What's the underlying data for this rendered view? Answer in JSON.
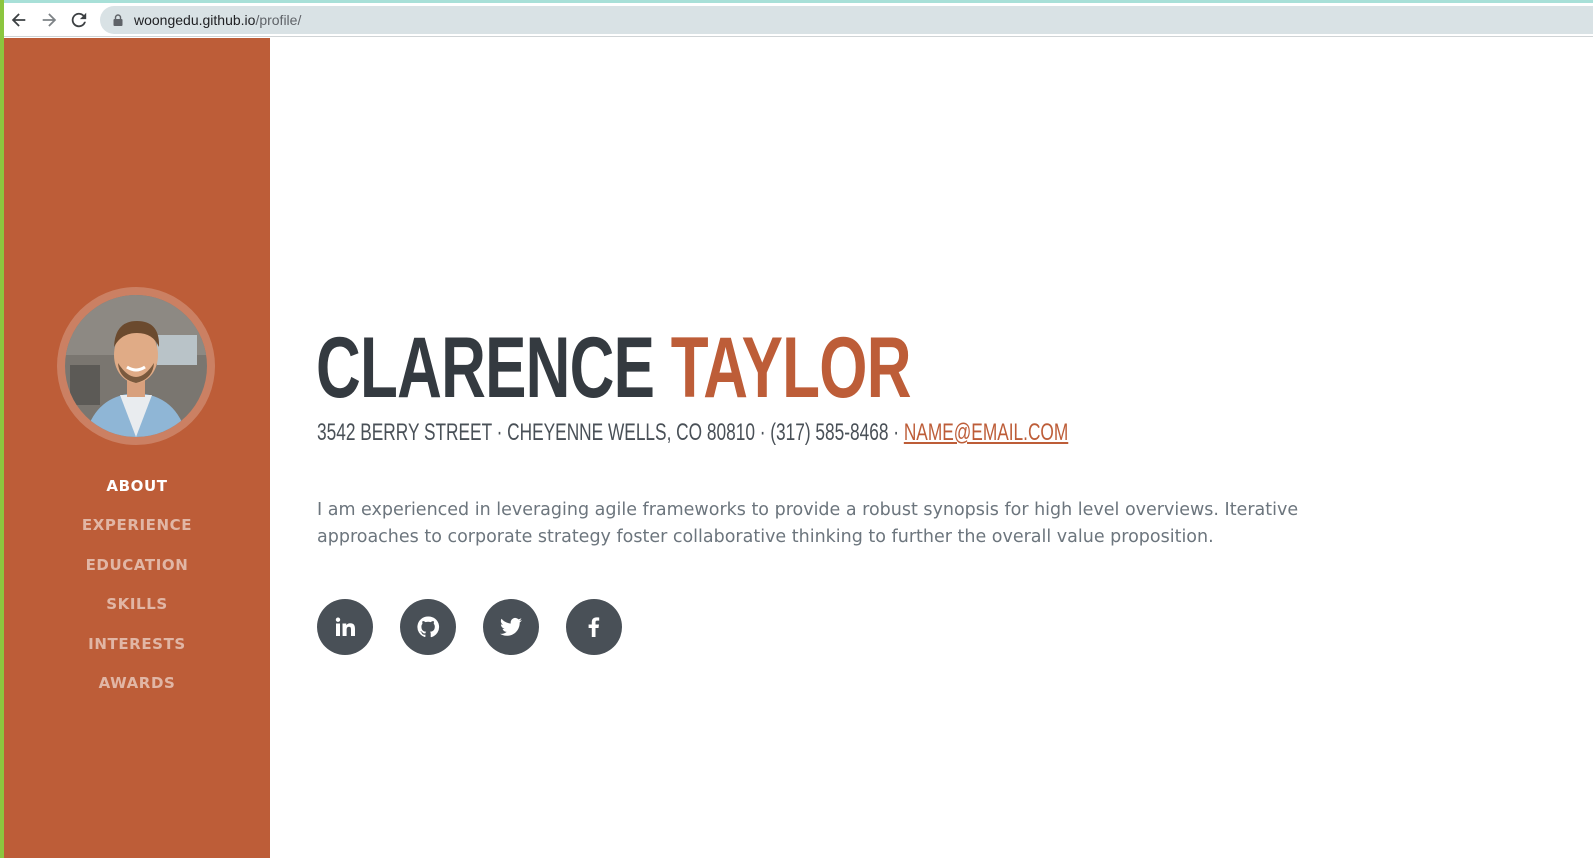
{
  "browser": {
    "url_host": "woongedu.github.io",
    "url_path": "/profile/",
    "icons": [
      "back-arrow-icon",
      "forward-arrow-icon",
      "reload-icon",
      "lock-icon"
    ]
  },
  "sidebar": {
    "avatar_alt": "profile photo",
    "nav": [
      {
        "label": "ABOUT",
        "active": true
      },
      {
        "label": "EXPERIENCE",
        "active": false
      },
      {
        "label": "EDUCATION",
        "active": false
      },
      {
        "label": "SKILLS",
        "active": false
      },
      {
        "label": "INTERESTS",
        "active": false
      },
      {
        "label": "AWARDS",
        "active": false
      }
    ]
  },
  "profile": {
    "first_name": "CLARENCE",
    "last_name": "TAYLOR",
    "address_text": "3542 BERRY STREET · CHEYENNE WELLS, CO 80810 · (317) 585-8468 · ",
    "email": "NAME@EMAIL.COM",
    "bio": "I am experienced in leveraging agile frameworks to provide a robust synopsis for high level overviews. Iterative approaches to corporate strategy foster collaborative thinking to further the overall value proposition."
  },
  "social": [
    "linkedin-icon",
    "github-icon",
    "twitter-icon",
    "facebook-icon"
  ],
  "colors": {
    "accent": "#bd5d38",
    "dark": "#343a40",
    "social_bg": "#495057",
    "text_muted": "#6c757d"
  }
}
